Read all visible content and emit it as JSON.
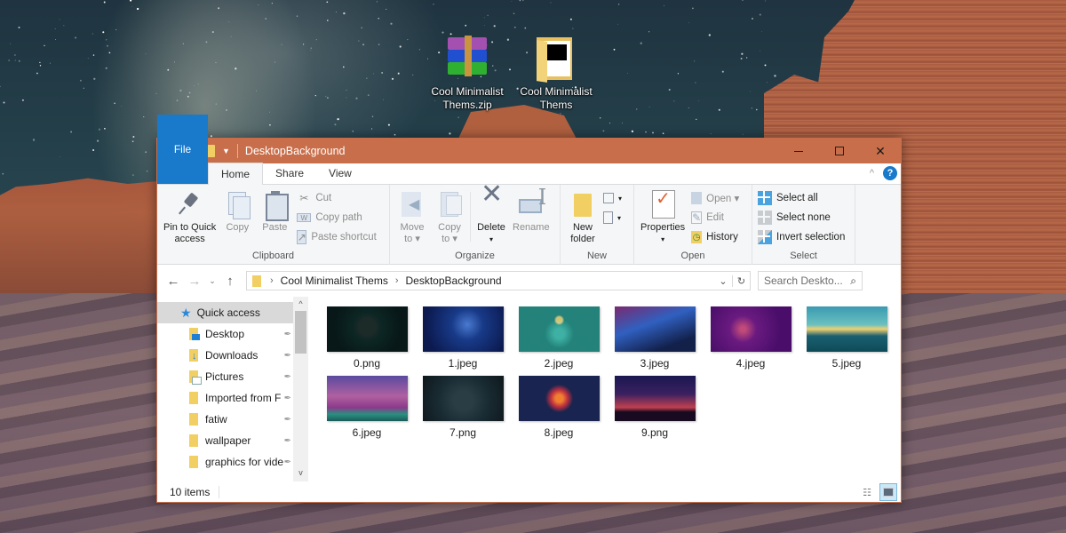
{
  "desktop": {
    "icons": [
      {
        "label": "Cool Minimalist Thems.zip",
        "icon": "winrar-archive-icon"
      },
      {
        "label": "Cool Minimalist Thems",
        "icon": "folder-icon"
      }
    ]
  },
  "window": {
    "title": "DesktopBackground",
    "controls": {
      "minimize": "minimize",
      "maximize": "maximize",
      "close": "✕"
    },
    "tabs": [
      {
        "label": "File"
      },
      {
        "label": "Home"
      },
      {
        "label": "Share"
      },
      {
        "label": "View"
      }
    ],
    "help": "?",
    "collapse": "^"
  },
  "ribbon": {
    "clipboard": {
      "label": "Clipboard",
      "pin": "Pin to Quick access",
      "pin_line1": "Pin to Quick",
      "pin_line2": "access",
      "copy": "Copy",
      "paste": "Paste",
      "cut": "Cut",
      "copy_path": "Copy path",
      "paste_shortcut": "Paste shortcut"
    },
    "organize": {
      "label": "Organize",
      "move_to_1": "Move",
      "move_to_2": "to ▾",
      "copy_to_1": "Copy",
      "copy_to_2": "to ▾",
      "delete": "Delete",
      "delete_arrow": "▾",
      "rename": "Rename"
    },
    "new": {
      "label": "New",
      "new_folder_1": "New",
      "new_folder_2": "folder",
      "new_item": "▾",
      "easy_access": "▾"
    },
    "open": {
      "label": "Open",
      "properties": "Properties",
      "properties_arrow": "▾",
      "open": "Open ▾",
      "edit": "Edit",
      "history": "History"
    },
    "select": {
      "label": "Select",
      "select_all": "Select all",
      "select_none": "Select none",
      "invert": "Invert selection"
    }
  },
  "navigation": {
    "back": "←",
    "forward": "→",
    "recent": "⌄",
    "up": "↑",
    "breadcrumb": [
      "Cool Minimalist Thems",
      "DesktopBackground"
    ],
    "crumb_sep": "›",
    "dropdown": "⌄",
    "refresh": "↻",
    "search_placeholder": "Search Deskto...",
    "search_icon": "⌕"
  },
  "nav_pane": {
    "quick_access": "Quick access",
    "items": [
      {
        "label": "Desktop",
        "pinned": true
      },
      {
        "label": "Downloads",
        "pinned": true
      },
      {
        "label": "Pictures",
        "pinned": true
      },
      {
        "label": "Imported from F",
        "pinned": true
      },
      {
        "label": "fatiw",
        "pinned": true
      },
      {
        "label": "wallpaper",
        "pinned": true
      },
      {
        "label": "graphics for vide",
        "pinned": true
      }
    ],
    "pin_glyph": "📌",
    "scroll_up": "^",
    "scroll_down": "v"
  },
  "files": [
    {
      "name": "0.png"
    },
    {
      "name": "1.jpeg"
    },
    {
      "name": "2.jpeg"
    },
    {
      "name": "3.jpeg"
    },
    {
      "name": "4.jpeg"
    },
    {
      "name": "5.jpeg"
    },
    {
      "name": "6.jpeg"
    },
    {
      "name": "7.png"
    },
    {
      "name": "8.jpeg"
    },
    {
      "name": "9.png"
    }
  ],
  "status": {
    "item_count": "10 items",
    "view_details": "details-view",
    "view_large": "large-icons-view"
  },
  "colors": {
    "titlebar": "#c86e4a",
    "file_tab": "#1979ca",
    "selected_nav": "#d9d9d9",
    "folder": "#f1cf62"
  }
}
